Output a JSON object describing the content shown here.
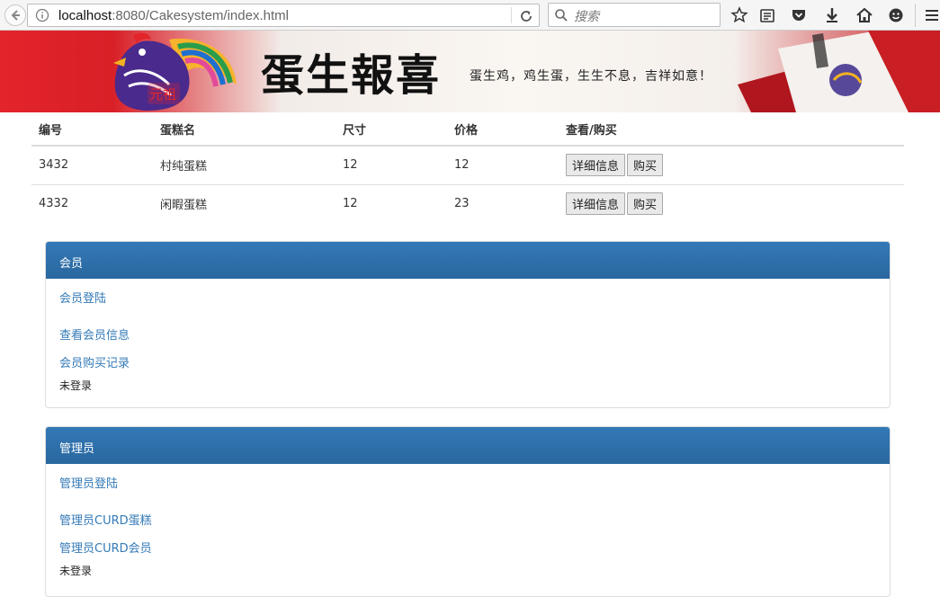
{
  "browser": {
    "url_host": "localhost",
    "url_rest": ":8080/Cakesystem/index.html",
    "search_placeholder": "搜索"
  },
  "banner": {
    "title": "蛋生報喜",
    "slogan": "蛋生鸡，鸡生蛋，生生不息，吉祥如意！",
    "seal_text": "元祖"
  },
  "table": {
    "headers": [
      "编号",
      "蛋糕名",
      "尺寸",
      "价格",
      "查看/购买"
    ],
    "rows": [
      {
        "id": "3432",
        "name": "村纯蛋糕",
        "size": "12",
        "price": "12"
      },
      {
        "id": "4332",
        "name": "闲暇蛋糕",
        "size": "12",
        "price": "23"
      }
    ],
    "detail_label": "详细信息",
    "buy_label": "购买"
  },
  "member_panel": {
    "title": "会员",
    "login": "会员登陆",
    "view_info": "查看会员信息",
    "purchase_records": "会员购买记录",
    "status": "未登录"
  },
  "admin_panel": {
    "title": "管理员",
    "login": "管理员登陆",
    "curd_cakes": "管理员CURD蛋糕",
    "curd_members": "管理员CURD会员",
    "status": "未登录"
  },
  "colors": {
    "panel_blue": "#337ab7",
    "banner_red": "#e3242b"
  }
}
